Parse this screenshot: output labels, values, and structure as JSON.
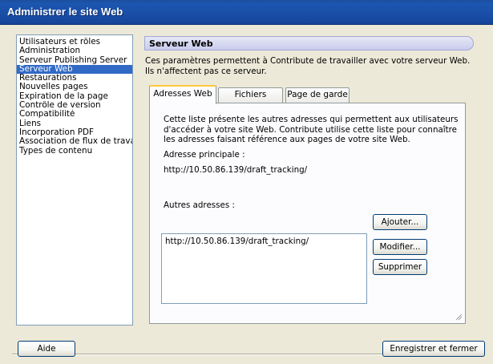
{
  "window": {
    "title": "Administrer le site Web"
  },
  "sidebar": {
    "items": [
      {
        "label": "Utilisateurs et rôles",
        "selected": false
      },
      {
        "label": "Administration",
        "selected": false
      },
      {
        "label": "Serveur Publishing Server",
        "selected": false
      },
      {
        "label": "Serveur Web",
        "selected": true
      },
      {
        "label": "Restaurations",
        "selected": false
      },
      {
        "label": "Nouvelles pages",
        "selected": false
      },
      {
        "label": "Expiration de la page",
        "selected": false
      },
      {
        "label": "Contrôle de version",
        "selected": false
      },
      {
        "label": "Compatibilité",
        "selected": false
      },
      {
        "label": "Liens",
        "selected": false
      },
      {
        "label": "Incorporation PDF",
        "selected": false
      },
      {
        "label": "Association de flux de travail",
        "selected": false
      },
      {
        "label": "Types de contenu",
        "selected": false
      }
    ]
  },
  "section": {
    "title": "Serveur Web",
    "intro": "Ces paramètres permettent à Contribute de travailler avec votre serveur Web. Ils n'affectent pas ce serveur."
  },
  "tabs": [
    {
      "label": "Adresses Web",
      "active": true
    },
    {
      "label": "Fichiers d'index",
      "active": false
    },
    {
      "label": "Page de garde",
      "active": false
    }
  ],
  "panel": {
    "description": "Cette liste présente les autres adresses qui permettent aux utilisateurs d'accéder à votre site Web. Contribute utilise cette liste pour connaître les adresses faisant référence aux pages de votre site Web.",
    "primary_label": "Adresse principale :",
    "primary_value": "http://10.50.86.139/draft_tracking/",
    "other_label": "Autres adresses :",
    "other_addresses": [
      "http://10.50.86.139/draft_tracking/"
    ],
    "buttons": {
      "add": "Ajouter...",
      "edit": "Modifier...",
      "delete": "Supprimer"
    }
  },
  "footer": {
    "help": "Aide",
    "save_close": "Enregistrer et fermer"
  },
  "colors": {
    "titlebar": "#1c56b0",
    "selection": "#316ac5",
    "tab_highlight": "#ffc83c",
    "dialog_bg": "#ece9d8"
  }
}
